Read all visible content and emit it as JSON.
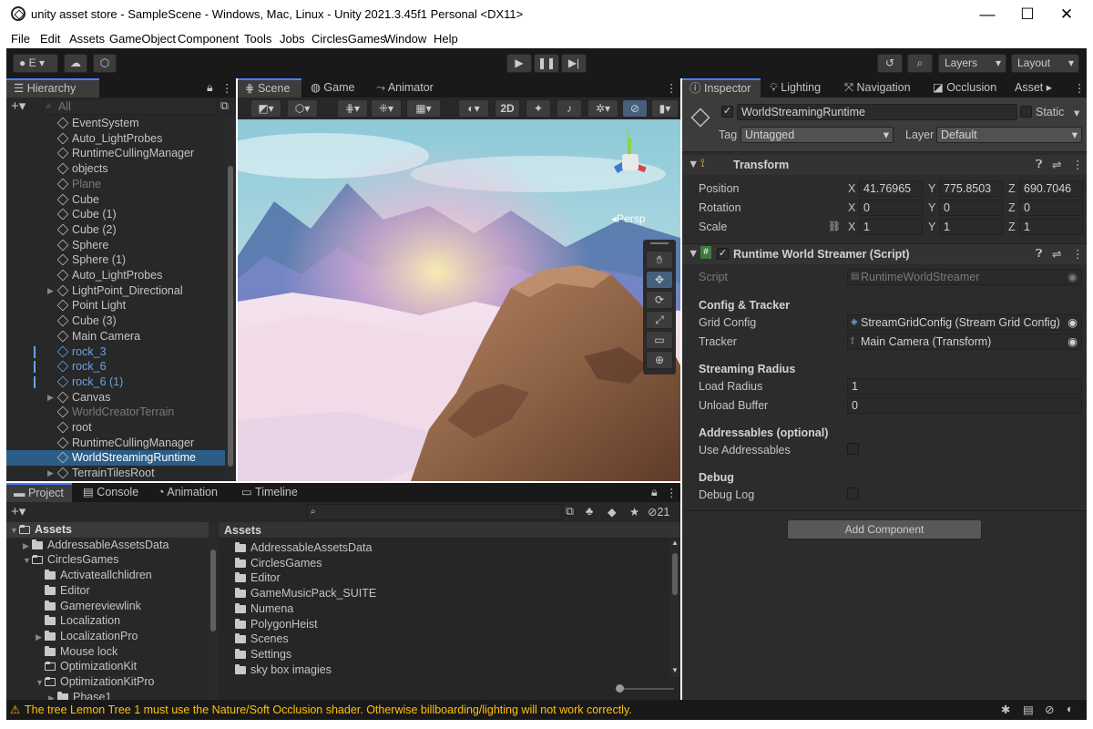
{
  "window": {
    "title": "unity asset store - SampleScene - Windows, Mac, Linux - Unity 2021.3.45f1 Personal <DX11>",
    "minimize": "—",
    "maximize": "☐",
    "close": "✕"
  },
  "menu": [
    "File",
    "Edit",
    "Assets",
    "GameObject",
    "Component",
    "Tools",
    "Jobs",
    "CirclesGames",
    "Window",
    "Help"
  ],
  "toolbar": {
    "account": "E",
    "layers": "Layers",
    "layout": "Layout"
  },
  "hierarchy": {
    "tab": "Hierarchy",
    "search_placeholder": "All",
    "items": [
      {
        "label": "EventSystem",
        "color": "normal",
        "arrow": ""
      },
      {
        "label": "Auto_LightProbes",
        "color": "normal",
        "arrow": ""
      },
      {
        "label": "RuntimeCullingManager",
        "color": "normal",
        "arrow": ""
      },
      {
        "label": "objects",
        "color": "normal",
        "arrow": ""
      },
      {
        "label": "Plane",
        "color": "dim",
        "arrow": ""
      },
      {
        "label": "Cube",
        "color": "normal",
        "arrow": ""
      },
      {
        "label": "Cube (1)",
        "color": "normal",
        "arrow": ""
      },
      {
        "label": "Cube (2)",
        "color": "normal",
        "arrow": ""
      },
      {
        "label": "Sphere",
        "color": "normal",
        "arrow": ""
      },
      {
        "label": "Sphere (1)",
        "color": "normal",
        "arrow": ""
      },
      {
        "label": "Auto_LightProbes",
        "color": "normal",
        "arrow": ""
      },
      {
        "label": "LightPoint_Directional",
        "color": "normal",
        "arrow": "▶"
      },
      {
        "label": "Point Light",
        "color": "normal",
        "arrow": ""
      },
      {
        "label": "Cube (3)",
        "color": "normal",
        "arrow": ""
      },
      {
        "label": "Main Camera",
        "color": "normal",
        "arrow": ""
      },
      {
        "label": "rock_3",
        "color": "blue",
        "arrow": ""
      },
      {
        "label": "rock_6",
        "color": "blue",
        "arrow": ""
      },
      {
        "label": "rock_6 (1)",
        "color": "blue",
        "arrow": ""
      },
      {
        "label": "Canvas",
        "color": "normal",
        "arrow": "▶"
      },
      {
        "label": "WorldCreatorTerrain",
        "color": "dim",
        "arrow": ""
      },
      {
        "label": "root",
        "color": "normal",
        "arrow": ""
      },
      {
        "label": "RuntimeCullingManager",
        "color": "normal",
        "arrow": ""
      },
      {
        "label": "WorldStreamingRuntime",
        "color": "selected",
        "arrow": ""
      },
      {
        "label": "TerrainTilesRoot",
        "color": "normal",
        "arrow": "▶"
      }
    ]
  },
  "scene": {
    "tabs": [
      "Scene",
      "Game",
      "Animator"
    ],
    "mode_2d": "2D",
    "persp": "Persp",
    "gizmo_y": "y"
  },
  "inspector": {
    "tabs": [
      "Inspector",
      "Lighting",
      "Navigation",
      "Occlusion",
      "Asset"
    ],
    "object_name": "WorldStreamingRuntime",
    "static_label": "Static",
    "tag_label": "Tag",
    "tag_value": "Untagged",
    "layer_label": "Layer",
    "layer_value": "Default",
    "transform": {
      "title": "Transform",
      "position": {
        "label": "Position",
        "x": "41.76965",
        "y": "775.8503",
        "z": "690.7046"
      },
      "rotation": {
        "label": "Rotation",
        "x": "0",
        "y": "0",
        "z": "0"
      },
      "scale": {
        "label": "Scale",
        "x": "1",
        "y": "1",
        "z": "1"
      }
    },
    "script_component": {
      "title": "Runtime World Streamer (Script)",
      "script_label": "Script",
      "script_value": "RuntimeWorldStreamer",
      "config_header": "Config & Tracker",
      "grid_config_label": "Grid Config",
      "grid_config_value": "StreamGridConfig (Stream Grid Config)",
      "tracker_label": "Tracker",
      "tracker_value": "Main Camera (Transform)",
      "radius_header": "Streaming Radius",
      "load_radius_label": "Load Radius",
      "load_radius_value": "1",
      "unload_buffer_label": "Unload Buffer",
      "unload_buffer_value": "0",
      "addressables_header": "Addressables (optional)",
      "use_addressables_label": "Use Addressables",
      "debug_header": "Debug",
      "debug_log_label": "Debug Log"
    },
    "add_component": "Add Component"
  },
  "project": {
    "tabs": [
      "Project",
      "Console",
      "Animation",
      "Timeline"
    ],
    "hidden_count": "21",
    "assets_root": "Assets",
    "assets_header": "Assets",
    "tree": [
      {
        "label": "Assets",
        "arrow": "▼",
        "type": "open",
        "indent": 0
      },
      {
        "label": "AddressableAssetsData",
        "arrow": "▶",
        "type": "folder",
        "indent": 1
      },
      {
        "label": "CirclesGames",
        "arrow": "▼",
        "type": "open",
        "indent": 1
      },
      {
        "label": "Activateallchlidren",
        "arrow": "",
        "type": "folder",
        "indent": 2
      },
      {
        "label": "Editor",
        "arrow": "",
        "type": "folder",
        "indent": 2
      },
      {
        "label": "Gamereviewlink",
        "arrow": "",
        "type": "folder",
        "indent": 2
      },
      {
        "label": "Localization",
        "arrow": "",
        "type": "folder",
        "indent": 2
      },
      {
        "label": "LocalizationPro",
        "arrow": "▶",
        "type": "folder",
        "indent": 2
      },
      {
        "label": "Mouse lock",
        "arrow": "",
        "type": "folder",
        "indent": 2
      },
      {
        "label": "OptimizationKit",
        "arrow": "",
        "type": "empty",
        "indent": 2
      },
      {
        "label": "OptimizationKitPro",
        "arrow": "▼",
        "type": "open",
        "indent": 2
      },
      {
        "label": "Phase1",
        "arrow": "▶",
        "type": "folder",
        "indent": 3
      }
    ],
    "files": [
      "AddressableAssetsData",
      "CirclesGames",
      "Editor",
      "GameMusicPack_SUITE",
      "Numena",
      "PolygonHeist",
      "Scenes",
      "Settings",
      "sky box imagies"
    ]
  },
  "status": {
    "message": "The tree Lemon Tree 1 must use the Nature/Soft Occlusion shader. Otherwise billboarding/lighting will not work correctly."
  },
  "colors": {
    "accent": "#4c7dff",
    "selected_row": "#2c5d87",
    "warning": "#ffc107",
    "blue_text": "#68a3e5"
  }
}
